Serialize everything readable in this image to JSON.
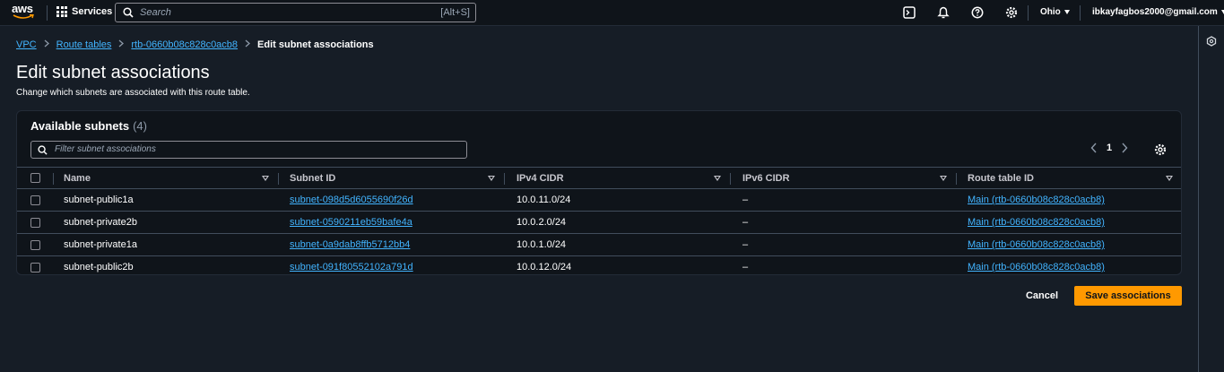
{
  "topnav": {
    "logo_text": "aws",
    "services_label": "Services",
    "search_placeholder": "Search",
    "search_shortcut": "[Alt+S]",
    "region": "Ohio",
    "account": "ibkayfagbos2000@gmail.com"
  },
  "breadcrumb": {
    "items": [
      "VPC",
      "Route tables",
      "rtb-0660b08c828c0acb8"
    ],
    "current": "Edit subnet associations"
  },
  "page": {
    "title": "Edit subnet associations",
    "description": "Change which subnets are associated with this route table."
  },
  "panel": {
    "title": "Available subnets",
    "count": "(4)",
    "filter_placeholder": "Filter subnet associations",
    "current_page": "1"
  },
  "table": {
    "columns": [
      "Name",
      "Subnet ID",
      "IPv4 CIDR",
      "IPv6 CIDR",
      "Route table ID"
    ],
    "rows": [
      {
        "name": "subnet-public1a",
        "subnet_id": "subnet-098d5d6055690f26d",
        "ipv4": "10.0.11.0/24",
        "ipv6": "–",
        "route_table": "Main (rtb-0660b08c828c0acb8)"
      },
      {
        "name": "subnet-private2b",
        "subnet_id": "subnet-0590211eb59bafe4a",
        "ipv4": "10.0.2.0/24",
        "ipv6": "–",
        "route_table": "Main (rtb-0660b08c828c0acb8)"
      },
      {
        "name": "subnet-private1a",
        "subnet_id": "subnet-0a9dab8ffb5712bb4",
        "ipv4": "10.0.1.0/24",
        "ipv6": "–",
        "route_table": "Main (rtb-0660b08c828c0acb8)"
      },
      {
        "name": "subnet-public2b",
        "subnet_id": "subnet-091f80552102a791d",
        "ipv4": "10.0.12.0/24",
        "ipv6": "–",
        "route_table": "Main (rtb-0660b08c828c0acb8)"
      }
    ]
  },
  "actions": {
    "cancel_label": "Cancel",
    "save_label": "Save associations"
  },
  "colors": {
    "accent": "#ff9900",
    "link": "#42b4ff",
    "background": "#161d26",
    "panel": "#0f141a"
  },
  "icons": [
    "grid-icon",
    "search-icon",
    "cloudshell-icon",
    "bell-icon",
    "help-icon",
    "gear-icon",
    "chevron-left-icon",
    "chevron-right-icon",
    "sort-icon",
    "panel-icon"
  ]
}
